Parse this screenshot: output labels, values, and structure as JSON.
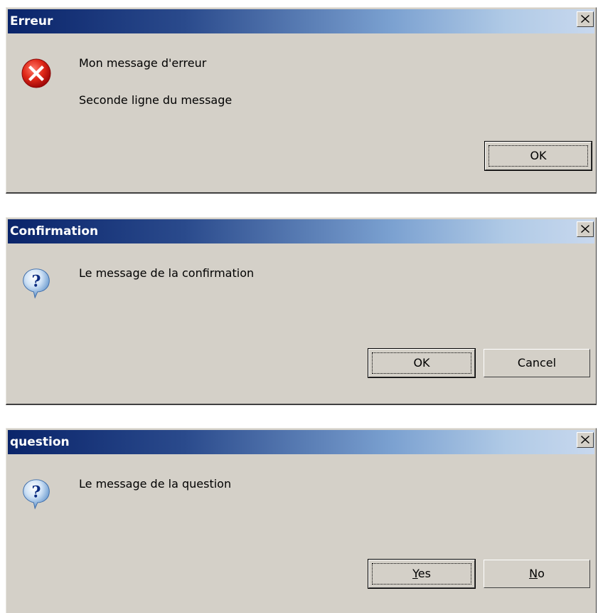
{
  "dialogs": [
    {
      "title": "Erreur",
      "icon": "error-icon",
      "lines": [
        "Mon message d'erreur",
        "Seconde ligne du message"
      ],
      "buttons": [
        "OK"
      ]
    },
    {
      "title": "Confirmation",
      "icon": "question-icon",
      "lines": [
        "Le message de la confirmation"
      ],
      "buttons": [
        "OK",
        "Cancel"
      ]
    },
    {
      "title": "question",
      "icon": "question-icon",
      "lines": [
        "Le message de la question"
      ],
      "buttons": [
        {
          "mnemonic": "Y",
          "rest": "es"
        },
        {
          "mnemonic": "N",
          "rest": "o"
        }
      ]
    }
  ],
  "colors": {
    "dialog_bg": "#d4d0c8",
    "titlebar_start": "#0a246a",
    "titlebar_end": "#c8d8ee",
    "error_red": "#d42020",
    "question_blue": "#3a7cc8"
  }
}
